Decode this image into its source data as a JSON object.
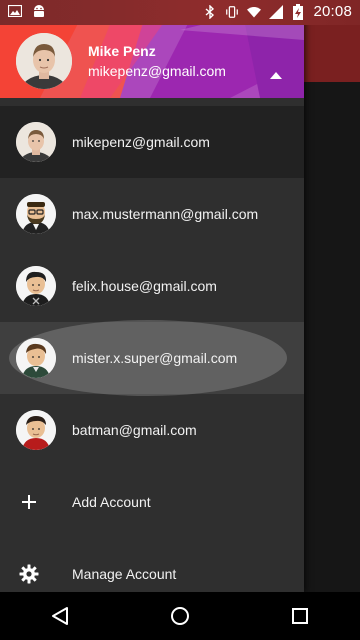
{
  "status_bar": {
    "time": "20:08",
    "icons": [
      "image-icon",
      "android-icon",
      "bluetooth-icon",
      "vibrate-icon",
      "wifi-icon",
      "signal-icon",
      "battery-charging-icon"
    ]
  },
  "header": {
    "name": "Mike Penz",
    "email": "mikepenz@gmail.com",
    "toggle_icon": "chevron-up-icon"
  },
  "accounts": [
    {
      "email": "mikepenz@gmail.com",
      "avatar": "mike-photo"
    },
    {
      "email": "max.mustermann@gmail.com",
      "avatar": "bearded-man-avatar"
    },
    {
      "email": "felix.house@gmail.com",
      "avatar": "dark-hair-man-avatar"
    },
    {
      "email": "mister.x.super@gmail.com",
      "avatar": "brown-hair-man-avatar"
    },
    {
      "email": "batman@gmail.com",
      "avatar": "red-jacket-man-avatar"
    }
  ],
  "actions": [
    {
      "label": "Add Account",
      "icon": "plus-icon"
    },
    {
      "label": "Manage Account",
      "icon": "gear-icon"
    }
  ],
  "colors": {
    "drawer_bg": "#2f2f2f",
    "selected_bg": "#222222",
    "header_accent": "#9c27b0",
    "header_red": "#e53935"
  }
}
